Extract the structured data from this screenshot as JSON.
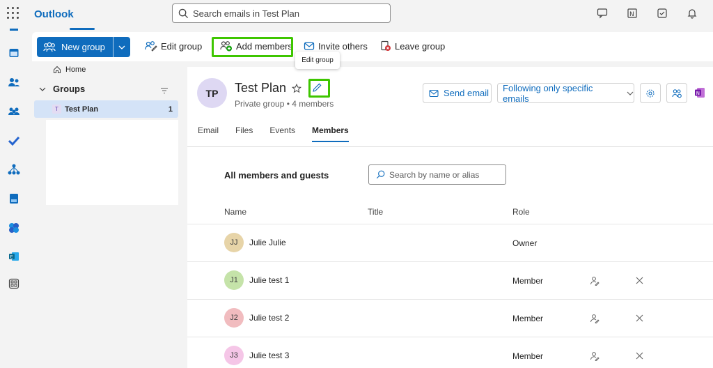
{
  "app": {
    "brand": "Outlook"
  },
  "search": {
    "placeholder": "Search emails in Test Plan"
  },
  "toolbar": {
    "new_group": "New group",
    "edit_group": "Edit group",
    "add_members": "Add members",
    "invite_others": "Invite others",
    "leave_group": "Leave group"
  },
  "tooltip": "Edit group",
  "nav": {
    "home": "Home",
    "groups": "Groups",
    "items": [
      {
        "label": "Test Plan",
        "badge": "T",
        "count": "1"
      }
    ]
  },
  "group": {
    "initials": "TP",
    "name": "Test Plan",
    "subtitle": "Private group • 4 members",
    "tabs": [
      "Email",
      "Files",
      "Events",
      "Members"
    ],
    "active_tab": "Members",
    "send_email": "Send email",
    "following": "Following only specific emails"
  },
  "members": {
    "title": "All members and guests",
    "search_placeholder": "Search by name or alias",
    "columns": {
      "name": "Name",
      "title": "Title",
      "role": "Role"
    },
    "rows": [
      {
        "initials": "JJ",
        "name": "Julie Julie",
        "role": "Owner",
        "color": "#e7d4a8"
      },
      {
        "initials": "J1",
        "name": "Julie test 1",
        "role": "Member",
        "color": "#c5e3a9"
      },
      {
        "initials": "J2",
        "name": "Julie test 2",
        "role": "Member",
        "color": "#f1bcbf"
      },
      {
        "initials": "J3",
        "name": "Julie test 3",
        "role": "Member",
        "color": "#f5c6e7"
      }
    ]
  },
  "colors": {
    "accent": "#0f6cbd",
    "highlight": "#3ec600",
    "selected": "#d4e3f7"
  }
}
